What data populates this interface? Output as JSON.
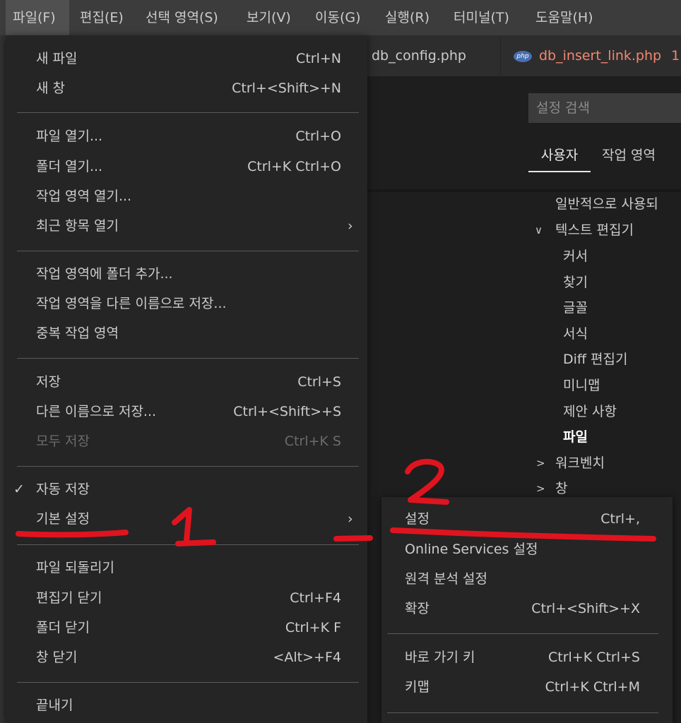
{
  "menubar": {
    "items": [
      "파일(F)",
      "편집(E)",
      "선택 영역(S)",
      "보기(V)",
      "이동(G)",
      "실행(R)",
      "터미널(T)",
      "도움말(H)"
    ]
  },
  "tabs": [
    {
      "label": "db_config.php"
    },
    {
      "label": "db_insert_link.php",
      "icon": "php-icon",
      "badge": "1",
      "color": "#f48771"
    }
  ],
  "settings": {
    "search_placeholder": "설정 검색",
    "tabs": [
      "사용자",
      "작업 영역"
    ],
    "toc": [
      {
        "label": "일반적으로 사용되"
      },
      {
        "label": "텍스트 편집기",
        "expanded": true
      },
      {
        "label": "커서"
      },
      {
        "label": "찾기"
      },
      {
        "label": "글꼴"
      },
      {
        "label": "서식"
      },
      {
        "label": "Diff 편집기"
      },
      {
        "label": "미니맵"
      },
      {
        "label": "제안 사항"
      },
      {
        "label": "파일",
        "selected": true
      },
      {
        "label": "워크벤치",
        "expanded": false
      },
      {
        "label": "창",
        "expanded": false
      }
    ]
  },
  "file_menu": {
    "items": [
      {
        "label": "새 파일",
        "shortcut": "Ctrl+N"
      },
      {
        "label": "새 창",
        "shortcut": "Ctrl+<Shift>+N"
      },
      {
        "label": "파일 열기...",
        "shortcut": "Ctrl+O"
      },
      {
        "label": "폴더 열기...",
        "shortcut": "Ctrl+K Ctrl+O"
      },
      {
        "label": "작업 영역 열기..."
      },
      {
        "label": "최근 항목 열기",
        "submenu": true
      },
      {
        "label": "작업 영역에 폴더 추가..."
      },
      {
        "label": "작업 영역을 다른 이름으로 저장..."
      },
      {
        "label": "중복 작업 영역"
      },
      {
        "label": "저장",
        "shortcut": "Ctrl+S"
      },
      {
        "label": "다른 이름으로 저장...",
        "shortcut": "Ctrl+<Shift>+S"
      },
      {
        "label": "모두 저장",
        "shortcut": "Ctrl+K S",
        "disabled": true
      },
      {
        "label": "자동 저장",
        "checked": true
      },
      {
        "label": "기본 설정",
        "submenu": true
      },
      {
        "label": "파일 되돌리기"
      },
      {
        "label": "편집기 닫기",
        "shortcut": "Ctrl+F4"
      },
      {
        "label": "폴더 닫기",
        "shortcut": "Ctrl+K F"
      },
      {
        "label": "창 닫기",
        "shortcut": "<Alt>+F4"
      },
      {
        "label": "끝내기"
      }
    ],
    "check_glyph": "✓",
    "submenu_glyph": "›"
  },
  "preferences_submenu": {
    "items": [
      {
        "label": "설정",
        "shortcut": "Ctrl+,"
      },
      {
        "label": "Online Services 설정"
      },
      {
        "label": "원격 분석 설정"
      },
      {
        "label": "확장",
        "shortcut": "Ctrl+<Shift>+X"
      },
      {
        "label": "바로 가기 키",
        "shortcut": "Ctrl+K Ctrl+S"
      },
      {
        "label": "키맵",
        "shortcut": "Ctrl+K Ctrl+M"
      }
    ]
  },
  "annotations": {
    "color": "#e0141e",
    "labels": [
      "1",
      "2"
    ]
  }
}
